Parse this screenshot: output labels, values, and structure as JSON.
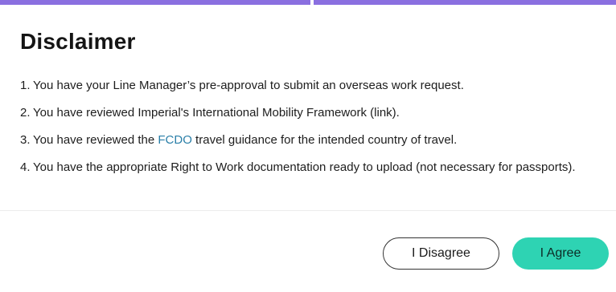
{
  "dialog": {
    "title": "Disclaimer",
    "items": [
      {
        "number": "1.",
        "text": "You have your Line Manager’s pre-approval to submit an overseas work request."
      },
      {
        "number": "2.",
        "text": "You have reviewed Imperial's International Mobility Framework (link)."
      },
      {
        "number": "3.",
        "text_before": "You have reviewed the ",
        "link": "FCDO",
        "text_after": " travel guidance for the intended country of travel."
      },
      {
        "number": "4.",
        "text": "You have the appropriate Right to Work documentation ready to upload (not necessary for passports)."
      }
    ],
    "buttons": {
      "disagree_label": "I Disagree",
      "agree_label": "I Agree"
    }
  },
  "colors": {
    "top_strip": "#8a6fe0",
    "link": "#2a7fa8",
    "agree_button": "#2ed3b3"
  }
}
